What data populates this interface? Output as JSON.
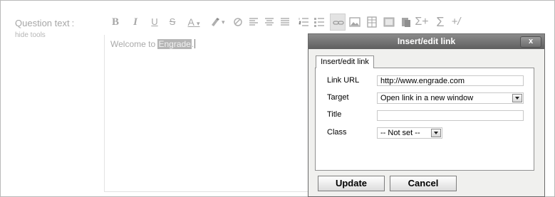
{
  "form": {
    "field_label": "Question text",
    "field_label_suffix": ":",
    "hide_tools_link": "hide tools"
  },
  "toolbar": {
    "buttons": [
      {
        "name": "bold",
        "glyph": "B"
      },
      {
        "name": "italic",
        "glyph": "I"
      },
      {
        "name": "underline",
        "glyph": "U"
      },
      {
        "name": "strikethrough",
        "glyph": "S"
      },
      {
        "name": "font-color",
        "glyph": "A"
      },
      {
        "name": "highlight-color",
        "glyph": "marker"
      },
      {
        "name": "eraser",
        "glyph": "eraser"
      },
      {
        "name": "align-left",
        "glyph": "lines"
      },
      {
        "name": "align-center",
        "glyph": "lines"
      },
      {
        "name": "align-justify",
        "glyph": "lines"
      },
      {
        "name": "numbered-list",
        "glyph": "list"
      },
      {
        "name": "bullet-list",
        "glyph": "list"
      },
      {
        "name": "insert-link",
        "glyph": "link"
      },
      {
        "name": "insert-image",
        "glyph": "image"
      },
      {
        "name": "insert-table",
        "glyph": "table"
      },
      {
        "name": "insert-media",
        "glyph": "media"
      },
      {
        "name": "paste",
        "glyph": "paste"
      },
      {
        "name": "equation",
        "glyph": "Σ+"
      },
      {
        "name": "sum",
        "glyph": "Σ"
      },
      {
        "name": "special-formula",
        "glyph": "+/"
      }
    ]
  },
  "editor": {
    "text_before": "Welcome to",
    "selected_text": "Engrade",
    "text_after": "."
  },
  "dialog": {
    "title": "Insert/edit link",
    "close_label": "x",
    "tab_label": "Insert/edit link",
    "link_url_label": "Link URL",
    "link_url_value": "http://www.engrade.com",
    "target_label": "Target",
    "target_value": "Open link in a new window",
    "title_label": "Title",
    "title_value": "",
    "class_label": "Class",
    "class_value": "-- Not set --",
    "update_button": "Update",
    "cancel_button": "Cancel"
  },
  "colors": {
    "dialog_title_bg": "#6f6f6f",
    "dialog_bg": "#f0f0ee",
    "selection_bg": "#b5b5b5",
    "muted_text": "#a6a6a6"
  }
}
